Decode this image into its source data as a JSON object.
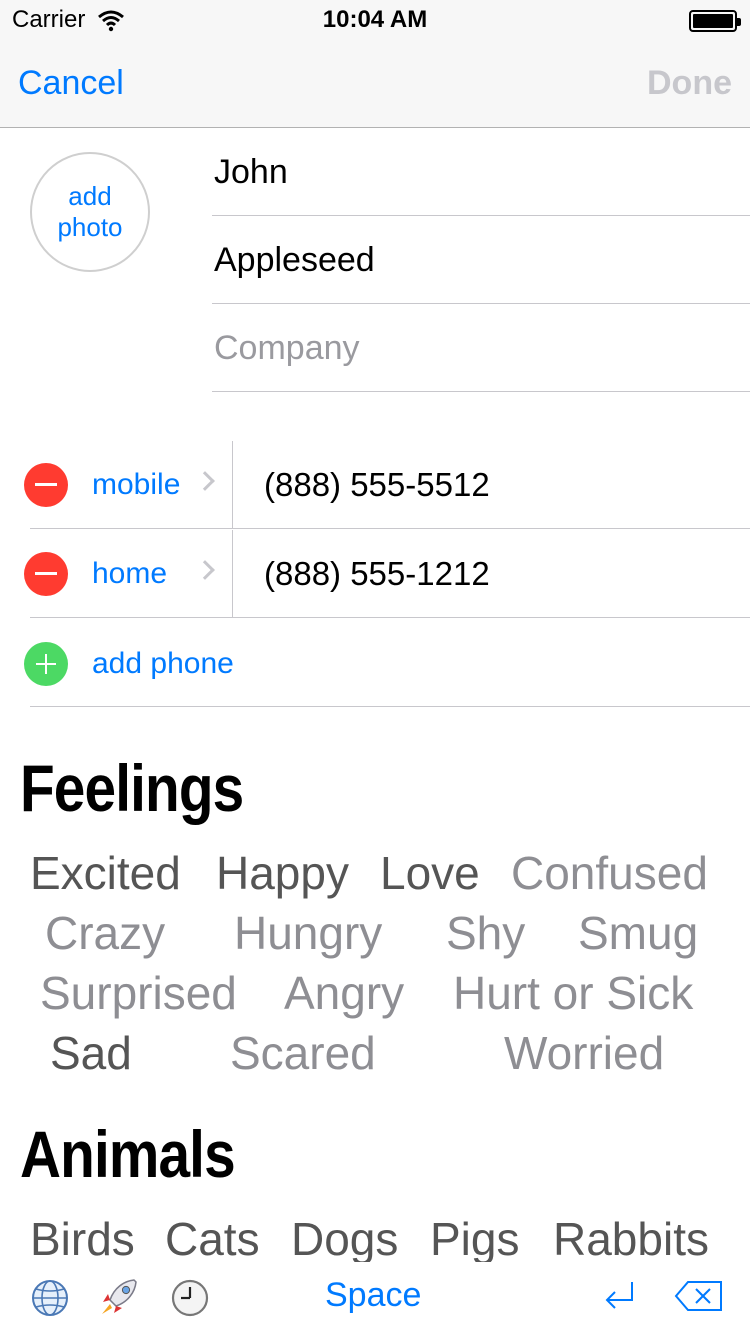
{
  "status": {
    "carrier": "Carrier",
    "time": "10:04 AM"
  },
  "nav": {
    "cancel": "Cancel",
    "done": "Done"
  },
  "contact": {
    "photo_label": "add photo",
    "first_name": "John",
    "last_name": "Appleseed",
    "company_placeholder": "Company"
  },
  "phones": [
    {
      "label": "mobile",
      "number": "(888) 555-5512"
    },
    {
      "label": "home",
      "number": "(888) 555-1212"
    }
  ],
  "add_phone": "add phone",
  "feelings": {
    "title": "Feelings",
    "words": [
      "Excited",
      "Happy",
      "Love",
      "Confused",
      "Crazy",
      "Hungry",
      "Shy",
      "Smug",
      "Surprised",
      "Angry",
      "Hurt or Sick",
      "Sad",
      "Scared",
      "Worried"
    ]
  },
  "animals": {
    "title": "Animals",
    "words": [
      "Birds",
      "Cats",
      "Dogs",
      "Pigs",
      "Rabbits"
    ]
  },
  "toolbar": {
    "space": "Space",
    "icons": [
      "globe-icon",
      "rocket-icon",
      "clock-icon",
      "return-icon",
      "delete-icon"
    ]
  },
  "colors": {
    "accent": "#007aff",
    "delete": "#ff3b30",
    "add": "#4cd964",
    "done_disabled": "#c7c7cc"
  }
}
